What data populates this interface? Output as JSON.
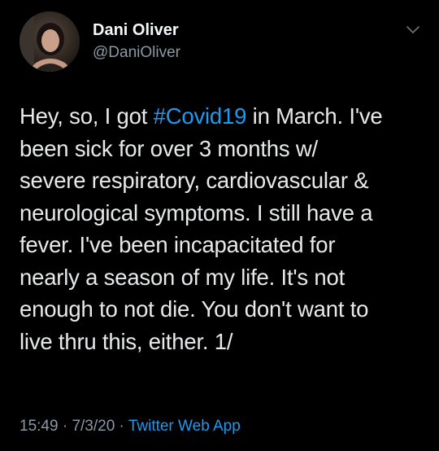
{
  "author": {
    "name": "Dani Oliver",
    "handle": "@DaniOliver"
  },
  "tweet": {
    "text_before": "Hey, so, I got ",
    "hashtag": "#Covid19",
    "text_after": " in March. I've\nbeen sick for over 3 months w/\nsevere respiratory, cardiovascular &\nneurological symptoms. I still have a\nfever. I've been incapacitated for\nnearly a season of my life. It's not\nenough to not die. You don't want to\nlive thru this, either. 1/"
  },
  "meta": {
    "time": "15:49",
    "separator": " · ",
    "date": "7/3/20",
    "source": "Twitter Web App"
  },
  "icons": {
    "more": "chevron-down-icon"
  },
  "colors": {
    "background": "#000000",
    "text": "#e7e9ea",
    "secondary": "#8b98a5",
    "accent": "#1d9bf0"
  }
}
